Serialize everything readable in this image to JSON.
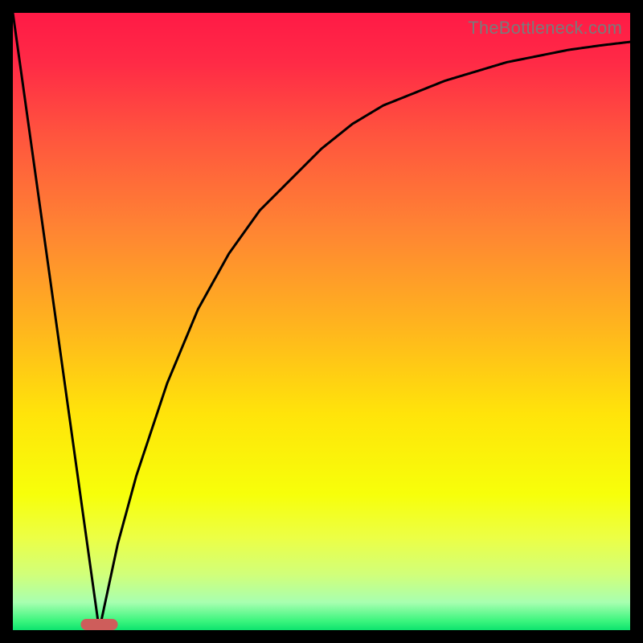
{
  "watermark": "TheBottleneck.com",
  "chart_data": {
    "type": "line",
    "title": "",
    "xlabel": "",
    "ylabel": "",
    "xlim": [
      0,
      100
    ],
    "ylim": [
      0,
      100
    ],
    "series": [
      {
        "name": "left-segment",
        "x": [
          0,
          14
        ],
        "values": [
          100,
          0
        ]
      },
      {
        "name": "right-curve",
        "x": [
          14,
          17,
          20,
          25,
          30,
          35,
          40,
          45,
          50,
          55,
          60,
          65,
          70,
          75,
          80,
          85,
          90,
          95,
          100
        ],
        "values": [
          0,
          14,
          25,
          40,
          52,
          61,
          68,
          73,
          78,
          82,
          85,
          87,
          89,
          90.5,
          92,
          93,
          94,
          94.7,
          95.3
        ]
      }
    ],
    "marker": {
      "name": "selected-range",
      "x": 14,
      "width": 6,
      "color": "#ce5d5b"
    },
    "background_gradient": [
      {
        "stop": 0.0,
        "color": "#ff1a46"
      },
      {
        "stop": 0.08,
        "color": "#ff2a46"
      },
      {
        "stop": 0.2,
        "color": "#ff553e"
      },
      {
        "stop": 0.35,
        "color": "#ff8433"
      },
      {
        "stop": 0.5,
        "color": "#ffb21f"
      },
      {
        "stop": 0.65,
        "color": "#ffe40a"
      },
      {
        "stop": 0.78,
        "color": "#f7ff0a"
      },
      {
        "stop": 0.85,
        "color": "#ecff45"
      },
      {
        "stop": 0.91,
        "color": "#d1ff7a"
      },
      {
        "stop": 0.955,
        "color": "#a8ffb0"
      },
      {
        "stop": 0.985,
        "color": "#3cf57e"
      },
      {
        "stop": 1.0,
        "color": "#0de36e"
      }
    ]
  }
}
